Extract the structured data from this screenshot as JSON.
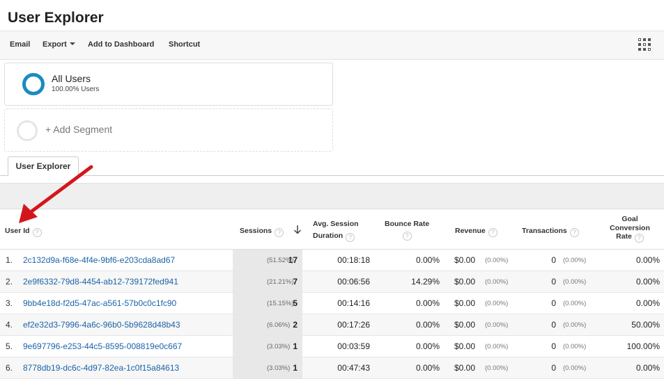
{
  "page": {
    "title": "User Explorer"
  },
  "toolbar": {
    "email": "Email",
    "export": "Export",
    "add_to_dashboard": "Add to Dashboard",
    "shortcut": "Shortcut"
  },
  "segments": {
    "all_users": {
      "name": "All Users",
      "sub": "100.00% Users"
    },
    "add_segment": "+ Add Segment"
  },
  "tab": "User Explorer",
  "table": {
    "headers": {
      "user_id": "User Id",
      "sessions": "Sessions",
      "avg_session_line1": "Avg. Session",
      "avg_session_line2": "Duration",
      "bounce_rate": "Bounce Rate",
      "revenue": "Revenue",
      "transactions": "Transactions",
      "goal_line1": "Goal",
      "goal_line2": "Conversion",
      "goal_line3": "Rate"
    },
    "help_glyph": "?",
    "rows": [
      {
        "idx": "1.",
        "id": "2c132d9a-f68e-4f4e-9bf6-e203cda8ad67",
        "sessions": "17",
        "sessions_pct": "(51.52%)",
        "duration": "00:18:18",
        "bounce": "0.00%",
        "revenue": "$0.00",
        "revenue_pct": "(0.00%)",
        "transactions": "0",
        "transactions_pct": "(0.00%)",
        "gcr": "0.00%"
      },
      {
        "idx": "2.",
        "id": "2e9f6332-79d8-4454-ab12-739172fed941",
        "sessions": "7",
        "sessions_pct": "(21.21%)",
        "duration": "00:06:56",
        "bounce": "14.29%",
        "revenue": "$0.00",
        "revenue_pct": "(0.00%)",
        "transactions": "0",
        "transactions_pct": "(0.00%)",
        "gcr": "0.00%"
      },
      {
        "idx": "3.",
        "id": "9bb4e18d-f2d5-47ac-a561-57b0c0c1fc90",
        "sessions": "5",
        "sessions_pct": "(15.15%)",
        "duration": "00:14:16",
        "bounce": "0.00%",
        "revenue": "$0.00",
        "revenue_pct": "(0.00%)",
        "transactions": "0",
        "transactions_pct": "(0.00%)",
        "gcr": "0.00%"
      },
      {
        "idx": "4.",
        "id": "ef2e32d3-7996-4a6c-96b0-5b9628d48b43",
        "sessions": "2",
        "sessions_pct": "(6.06%)",
        "duration": "00:17:26",
        "bounce": "0.00%",
        "revenue": "$0.00",
        "revenue_pct": "(0.00%)",
        "transactions": "0",
        "transactions_pct": "(0.00%)",
        "gcr": "50.00%"
      },
      {
        "idx": "5.",
        "id": "9e697796-e253-44c5-8595-008819e0c667",
        "sessions": "1",
        "sessions_pct": "(3.03%)",
        "duration": "00:03:59",
        "bounce": "0.00%",
        "revenue": "$0.00",
        "revenue_pct": "(0.00%)",
        "transactions": "0",
        "transactions_pct": "(0.00%)",
        "gcr": "100.00%"
      },
      {
        "idx": "6.",
        "id": "8778db19-dc6c-4d97-82ea-1c0f15a84613",
        "sessions": "1",
        "sessions_pct": "(3.03%)",
        "duration": "00:47:43",
        "bounce": "0.00%",
        "revenue": "$0.00",
        "revenue_pct": "(0.00%)",
        "transactions": "0",
        "transactions_pct": "(0.00%)",
        "gcr": "0.00%"
      }
    ]
  },
  "icons": {
    "grid": "grid-icon",
    "sort": "sort-down-arrow-icon",
    "annotation": "red-arrow-annotation"
  },
  "colors": {
    "ring_accent": "#1a8bc1",
    "link": "#1b63a8",
    "annotation": "#d4161c"
  }
}
